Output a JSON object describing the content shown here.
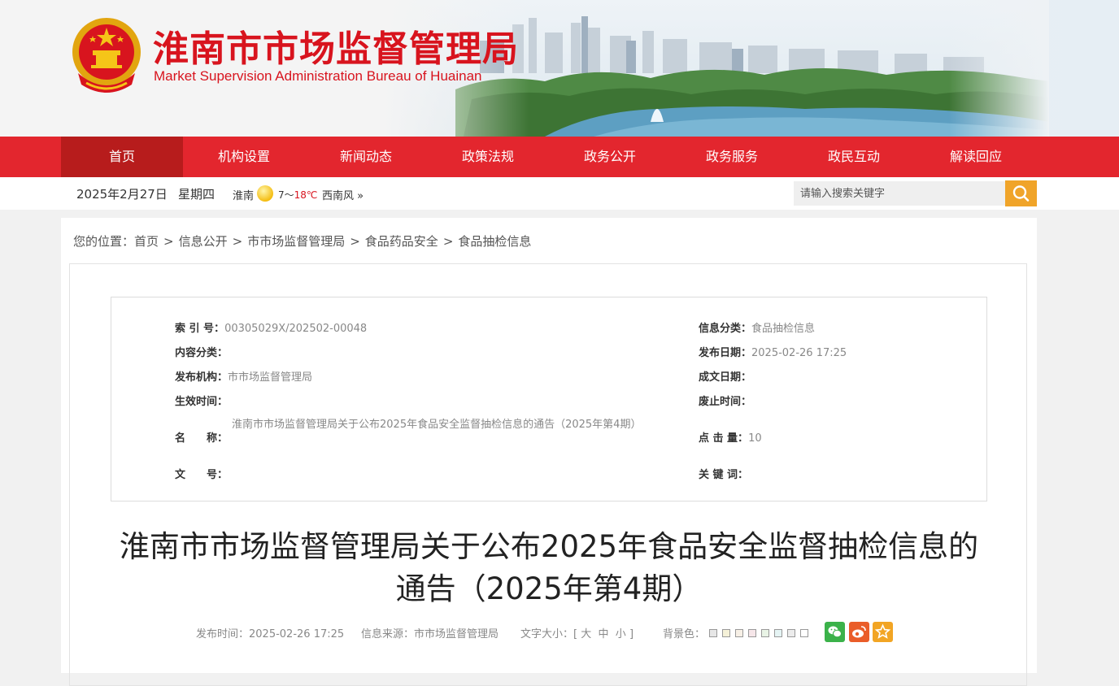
{
  "header": {
    "title": "淮南市市场监督管理局",
    "subtitle": "Market Supervision Administration Bureau of Huainan",
    "brand_color": "#d8141e"
  },
  "nav": {
    "items": [
      "首页",
      "机构设置",
      "新闻动态",
      "政策法规",
      "政务公开",
      "政务服务",
      "政民互动",
      "解读回应"
    ],
    "active": "首页",
    "color": "#e3262e",
    "active_color": "#b71c1c"
  },
  "infobar": {
    "date": "2025年2月27日",
    "weekday": "星期四",
    "city": "淮南",
    "weather_icon": "sun-icon",
    "temp_low": "7",
    "temp_sep": "～",
    "temp_high": "18℃",
    "wind": "西南风",
    "more": "»",
    "search_placeholder": "请输入搜索关键字"
  },
  "breadcrumb": {
    "prefix": "您的位置：",
    "items": [
      "首页",
      "信息公开",
      "市市场监督管理局",
      "食品药品安全",
      "食品抽检信息"
    ],
    "separator": ">"
  },
  "meta": {
    "index_label": "索 引 号：",
    "index_value": "00305029X/202502-00048",
    "category_label": "信息分类：",
    "category_value": "食品抽检信息",
    "content_label": "内容分类：",
    "content_value": "",
    "publish_date_label": "发布日期：",
    "publish_date_value": "2025-02-26 17:25",
    "org_label": "发布机构：",
    "org_value": "市市场监督管理局",
    "created_label": "成文日期：",
    "created_value": "",
    "effective_label": "生效时间：",
    "effective_value": "",
    "expire_label": "废止时间：",
    "expire_value": "",
    "name_label": "名　　称：",
    "name_value": "淮南市市场监督管理局关于公布2025年食品安全监督抽检信息的通告（2025年第4期）",
    "clicks_label": "点 击 量：",
    "clicks_value": "10",
    "docno_label": "文　　号：",
    "docno_value": "",
    "keywords_label": "关 键 词：",
    "keywords_value": ""
  },
  "article": {
    "title_line1": "淮南市市场监督管理局关于公布2025年食品安全监督抽检信息的",
    "title_line2": "通告（2025年第4期）",
    "publish_time_label": "发布时间：",
    "publish_time": "2025-02-26 17:25",
    "source_label": "信息来源：",
    "source": "市市场监督管理局",
    "font_size_label": "文字大小：",
    "font_open": "[",
    "font_large": "大",
    "font_medium": "中",
    "font_small": "小",
    "font_close": "]",
    "bg_label": "背景色：",
    "bg_colors": [
      "#e6e6e6",
      "#f5f1d8",
      "#f7f0e6",
      "#f6e6e9",
      "#e9f4e6",
      "#e5f4f4",
      "#ececec",
      "#ffffff"
    ],
    "share": [
      {
        "icon": "wechat-icon",
        "color": "#3bb24a"
      },
      {
        "icon": "weibo-icon",
        "color": "#ea5d29"
      },
      {
        "icon": "favorite-icon",
        "color": "#f2a524"
      }
    ]
  }
}
